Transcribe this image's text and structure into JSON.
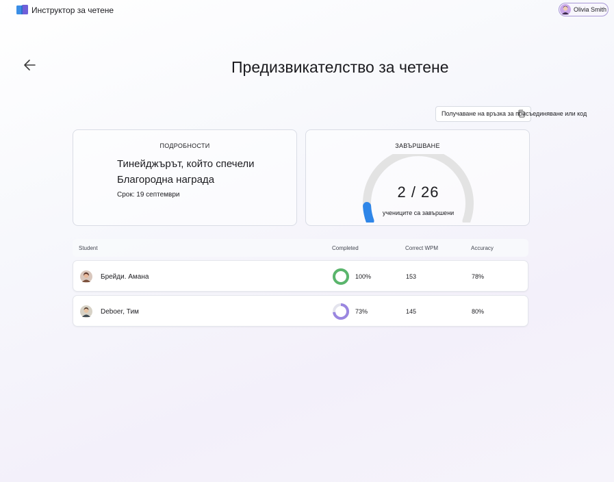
{
  "app": {
    "title": "Инструктор за четене",
    "icon": "book-icon"
  },
  "user": {
    "name": "Olivia Smith"
  },
  "page": {
    "title": "Предизвикателство за четене"
  },
  "actions": {
    "join_link": "Получаване на връзка за присъединяване или код",
    "copy_icon": "copy-icon"
  },
  "details": {
    "heading": "ПОДРОБНОСТИ",
    "story_title": "Тинейджърът, който спечели Благородна награда",
    "due": "Срок: 19 септември"
  },
  "completion": {
    "heading": "ЗАВЪРШВАНЕ",
    "completed": 2,
    "total": 26,
    "value_text": "2 / 26",
    "caption": "учениците са завършени",
    "accent": "#2f86e8",
    "track": "#e3e3e3"
  },
  "table": {
    "columns": [
      "Student",
      "Completed",
      "Correct WPM",
      "Accuracy"
    ],
    "rows": [
      {
        "name": "Брейди. Амана",
        "completed": "100%",
        "completed_fraction": 1.0,
        "ring_color": "#5ab56c",
        "wpm": "153",
        "accuracy": "78%"
      },
      {
        "name": "Deboer, Тим",
        "completed": "73%",
        "completed_fraction": 0.73,
        "ring_color": "#9a86e0",
        "wpm": "145",
        "accuracy": "80%"
      }
    ]
  }
}
